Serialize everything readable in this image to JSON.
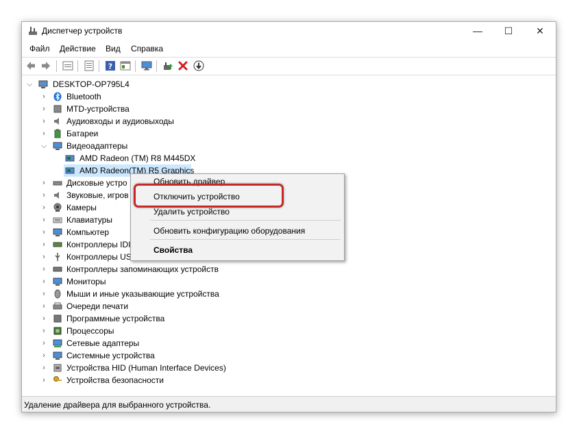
{
  "window": {
    "title": "Диспетчер устройств",
    "controls": {
      "minimize": "—",
      "maximize": "☐",
      "close": "✕"
    }
  },
  "menu": [
    "Файл",
    "Действие",
    "Вид",
    "Справка"
  ],
  "toolbar": [
    "back-arrow-icon",
    "forward-arrow-icon",
    "properties-grid-icon",
    "list-icon",
    "help-icon",
    "details-icon",
    "monitor-icon",
    "update-driver-icon",
    "uninstall-red-x-icon",
    "download-icon"
  ],
  "tree": {
    "root": "DESKTOP-OP795L4",
    "items": [
      "Bluetooth",
      "MTD-устройства",
      "Аудиовходы и аудиовыходы",
      "Батареи",
      "Видеоадаптеры",
      "AMD Radeon (TM) R8 M445DX",
      "AMD Radeon(TM) R5 Graphics",
      "Дисковые устро",
      "Звуковые, игров",
      "Камеры",
      "Клавиатуры",
      "Компьютер",
      "Контроллеры IDI",
      "Контроллеры US",
      "Контроллеры запоминающих устройств",
      "Мониторы",
      "Мыши и иные указывающие устройства",
      "Очереди печати",
      "Программные устройства",
      "Процессоры",
      "Сетевые адаптеры",
      "Системные устройства",
      "Устройства HID (Human Interface Devices)",
      "Устройства безопасности"
    ]
  },
  "context_menu": {
    "items": [
      "Обновить драйвер",
      "Отключить устройство",
      "Удалить устройство",
      "Обновить конфигурацию оборудования",
      "Свойства"
    ]
  },
  "status_bar": "Удаление драйвера для выбранного устройства.",
  "colors": {
    "highlight_border": "#c62828",
    "selection": "#cce8ff"
  }
}
